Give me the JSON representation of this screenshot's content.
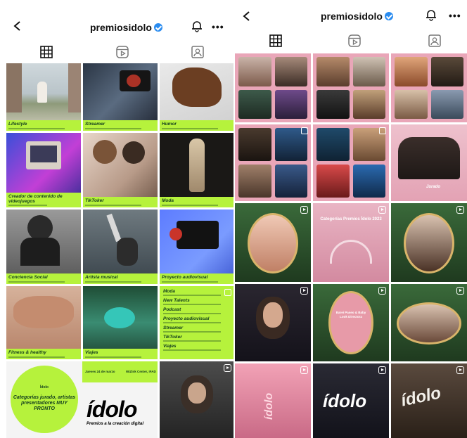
{
  "profile": {
    "username": "premiosidolo"
  },
  "left_grid": {
    "row1": [
      "Lifestyle",
      "Streamer",
      "Humor"
    ],
    "row2": [
      "Creador de contenido de videojuegos",
      "TikToker",
      "Moda"
    ],
    "row3": [
      "Conciencia Social",
      "Artista musical",
      "Proyecto audiovisual"
    ],
    "row4": [
      "Fitness & healthy",
      "Viajes"
    ],
    "row4_list": [
      "Moda",
      "New Talents",
      "Podcast",
      "Proyecto audiovisual",
      "Streamer",
      "TikToker",
      "Viajes"
    ],
    "promo": {
      "small": "Ídolo",
      "headline": "Categorías jurado, artistas presentadores MUY PRONTO",
      "date": "Jueves 24 de marzo",
      "venue": "WiZink Center, IFAD",
      "logo": "ídolo",
      "tagline": "Premios a la creación digital"
    }
  },
  "right_grid": {
    "jurado_label": "Jurado",
    "categorias_title": "Categorías Premios Ídolo 2023",
    "barei_title": "Barei Paseo & Baby Look Directora",
    "logo": "ídolo"
  },
  "colors": {
    "accent_green": "#b6f23c",
    "verified_blue": "#2a8cf0",
    "pink": "#e9a6b8"
  }
}
